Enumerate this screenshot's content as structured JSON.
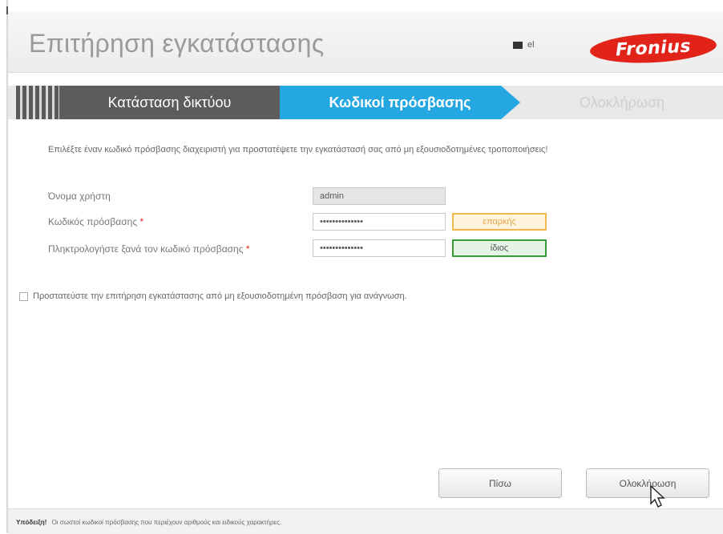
{
  "app_title": "Επιτήρηση εγκατάστασης",
  "language": {
    "code": "el",
    "icon": "flag-icon"
  },
  "logo_text": "Fronius",
  "steps": [
    {
      "label": "Κατάσταση δικτύου",
      "state": "done"
    },
    {
      "label": "Κωδικοί πρόσβασης",
      "state": "active"
    },
    {
      "label": "Ολοκλήρωση",
      "state": "pending"
    }
  ],
  "intro": "Επιλέξτε έναν κωδικό πρόσβασης διαχειριστή για προστατέψετε την εγκατάστασή σας από μη εξουσιοδοτημένες τροποποιήσεις!",
  "form": {
    "username_label": "Όνομα χρήστη",
    "username_value": "admin",
    "password_label": "Κωδικός πρόσβασης",
    "password_value": "••••••••••••••",
    "password_strength": "επαρκής",
    "confirm_label": "Πληκτρολογήστε ξανά τον κωδικό πρόσβασης",
    "confirm_value": "••••••••••••••",
    "confirm_status": "ίδιος",
    "required_mark": "*"
  },
  "protect_label": "Προστατεύστε την επιτήρηση εγκατάστασης από μη εξουσιοδοτημένη πρόσβαση για ανάγνωση.",
  "buttons": {
    "back": "Πίσω",
    "finish": "Ολοκλήρωση"
  },
  "footer": {
    "prefix": "Υπόδειξη!",
    "text": "Οι σωστοί κωδικοί πρόσβασης που περιέχουν αριθμούς και ειδικούς χαρακτήρες."
  },
  "colors": {
    "accent": "#25a7e1",
    "brand": "#e2231a",
    "warn": "#f2b84b",
    "ok": "#3a9b3a"
  }
}
